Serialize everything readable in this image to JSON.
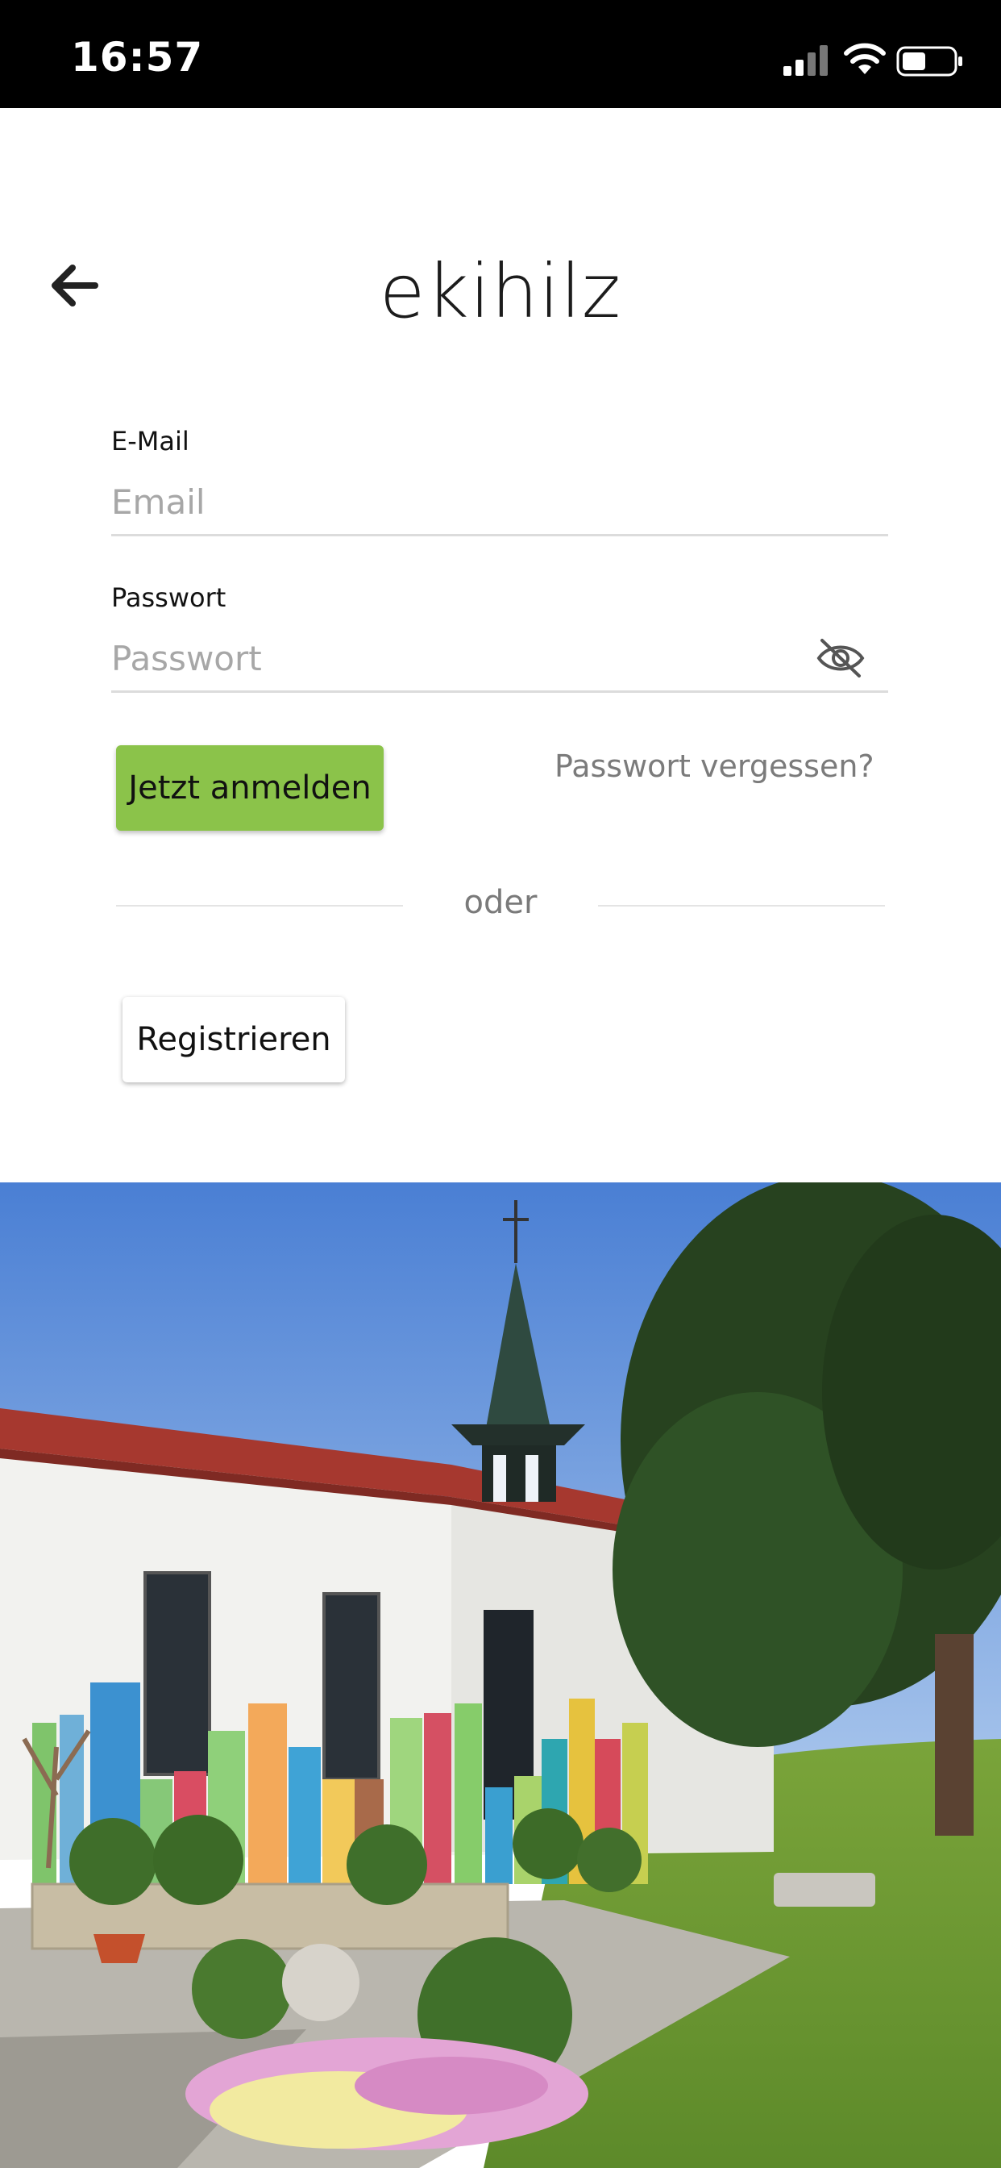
{
  "status_bar": {
    "time": "16:57",
    "icons": [
      "signal-icon",
      "wifi-icon",
      "battery-icon"
    ]
  },
  "header": {
    "title": "ekihilz",
    "back_icon": "arrow-left-icon"
  },
  "form": {
    "email": {
      "label": "E-Mail",
      "placeholder": "Email",
      "value": ""
    },
    "password": {
      "label": "Passwort",
      "placeholder": "Passwort",
      "value": "",
      "toggle_icon": "eye-slash-icon"
    },
    "login_label": "Jetzt anmelden",
    "forgot_label": "Passwort vergessen?",
    "divider_label": "oder",
    "register_label": "Registrieren"
  },
  "colors": {
    "accent": "#8bc34a",
    "status_bar": "#000000",
    "text": "#1c1c1c",
    "muted": "#7b7b7b"
  }
}
